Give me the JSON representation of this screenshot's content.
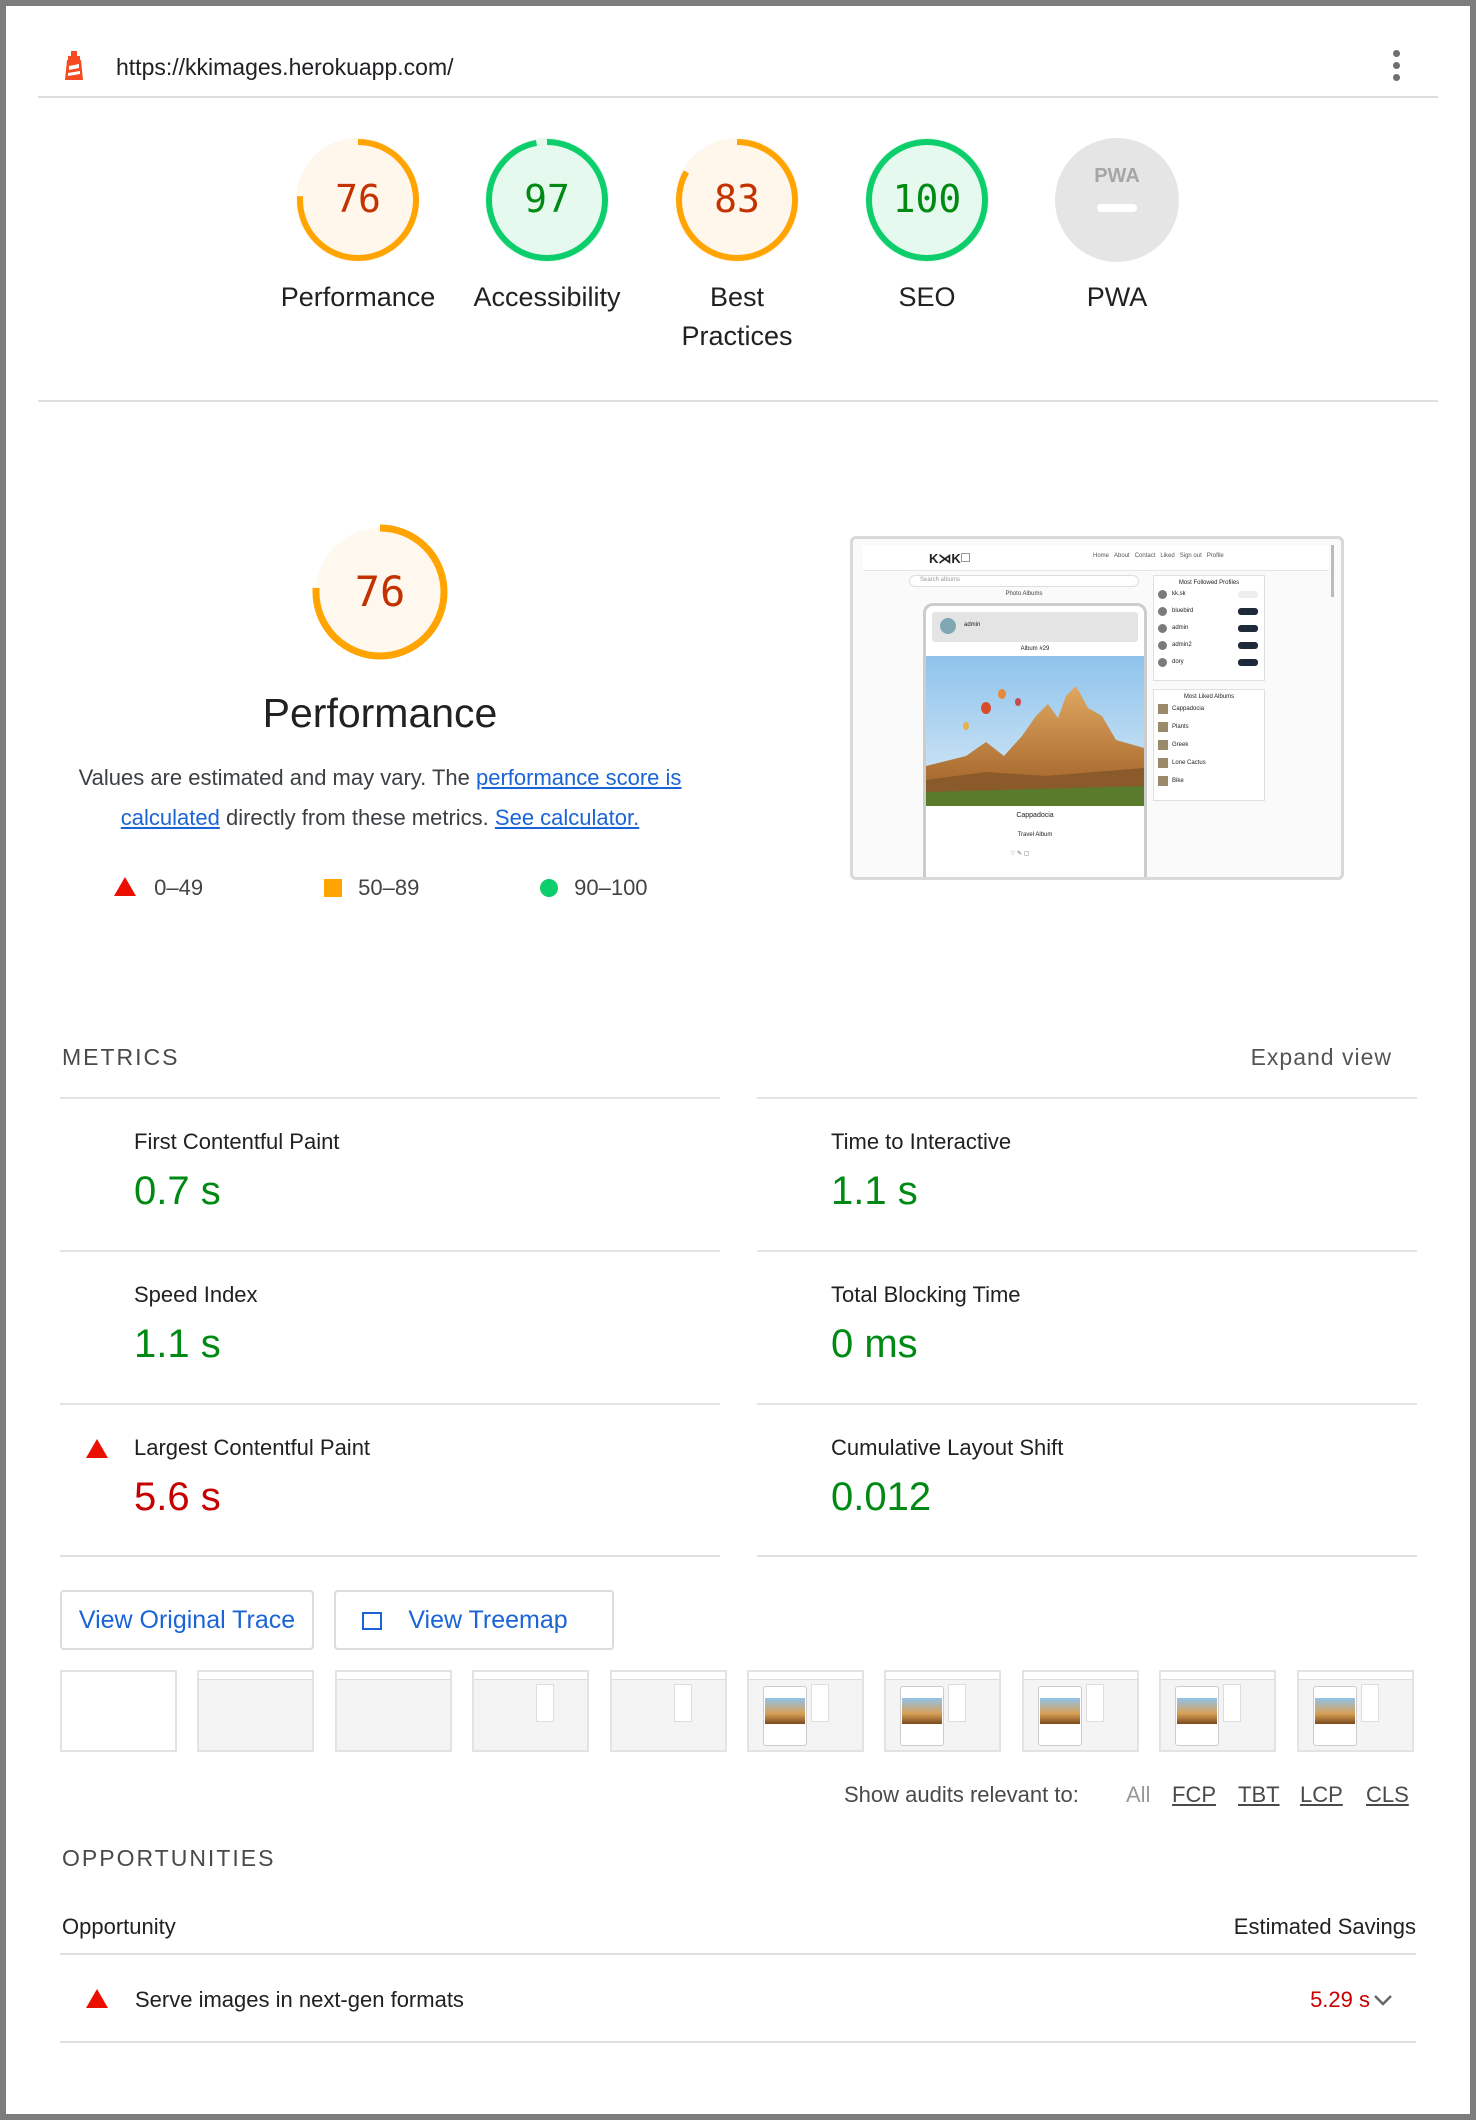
{
  "url": "https://kkimages.herokuapp.com/",
  "colors": {
    "fail": "#eb0f00",
    "average": "#ffa400",
    "pass": "#0cce6b",
    "link": "#1a64d6"
  },
  "gauges": [
    {
      "score": "76",
      "label": "Performance",
      "status": "average",
      "fraction": 0.76
    },
    {
      "score": "97",
      "label": "Accessibility",
      "status": "pass",
      "fraction": 0.97
    },
    {
      "score": "83",
      "label": "Best\nPractices",
      "status": "average",
      "fraction": 0.83
    },
    {
      "score": "100",
      "label": "SEO",
      "status": "pass",
      "fraction": 1.0
    },
    {
      "score": "PWA",
      "label": "PWA",
      "status": "na",
      "fraction": 0
    }
  ],
  "performance": {
    "score": "76",
    "title": "Performance",
    "desc_pre": "Values are estimated and may vary. The ",
    "desc_link1": "performance score is calculated",
    "desc_mid": " directly from these metrics. ",
    "desc_link2": "See calculator.",
    "legend": [
      "0–49",
      "50–89",
      "90–100"
    ]
  },
  "metrics_section": {
    "title": "METRICS",
    "expand": "Expand view",
    "items": [
      {
        "label": "First Contentful Paint",
        "value": "0.7 s",
        "status": "pass"
      },
      {
        "label": "Time to Interactive",
        "value": "1.1 s",
        "status": "pass"
      },
      {
        "label": "Speed Index",
        "value": "1.1 s",
        "status": "pass"
      },
      {
        "label": "Total Blocking Time",
        "value": "0 ms",
        "status": "pass"
      },
      {
        "label": "Largest Contentful Paint",
        "value": "5.6 s",
        "status": "fail"
      },
      {
        "label": "Cumulative Layout Shift",
        "value": "0.012",
        "status": "pass"
      }
    ]
  },
  "buttons": {
    "trace": "View Original Trace",
    "treemap": "View Treemap"
  },
  "audit_filter": {
    "label": "Show audits relevant to:",
    "options": [
      "All",
      "FCP",
      "TBT",
      "LCP",
      "CLS"
    ]
  },
  "opportunities": {
    "title": "OPPORTUNITIES",
    "col_opportunity": "Opportunity",
    "col_savings": "Estimated Savings",
    "items": [
      {
        "label": "Serve images in next-gen formats",
        "savings": "5.29 s",
        "status": "fail"
      }
    ]
  },
  "screenshot": {
    "nav_items": [
      "Home",
      "About",
      "Contact",
      "Liked",
      "Sign out",
      "Profile"
    ],
    "search_placeholder": "Search albums",
    "photo_albums_heading": "Photo Albums",
    "card_user": "admin",
    "card_album": "Album #29",
    "card_place": "Cappadocia",
    "card_caption": "Travel Album",
    "profiles_heading": "Most Followed Profiles",
    "profiles": [
      "kk.sk",
      "bluebird",
      "admin",
      "admin2",
      "dory"
    ],
    "albums_heading": "Most Liked Albums",
    "albums": [
      "Cappadocia",
      "Plants",
      "Greek",
      "Lone Cactus",
      "Bike"
    ]
  }
}
